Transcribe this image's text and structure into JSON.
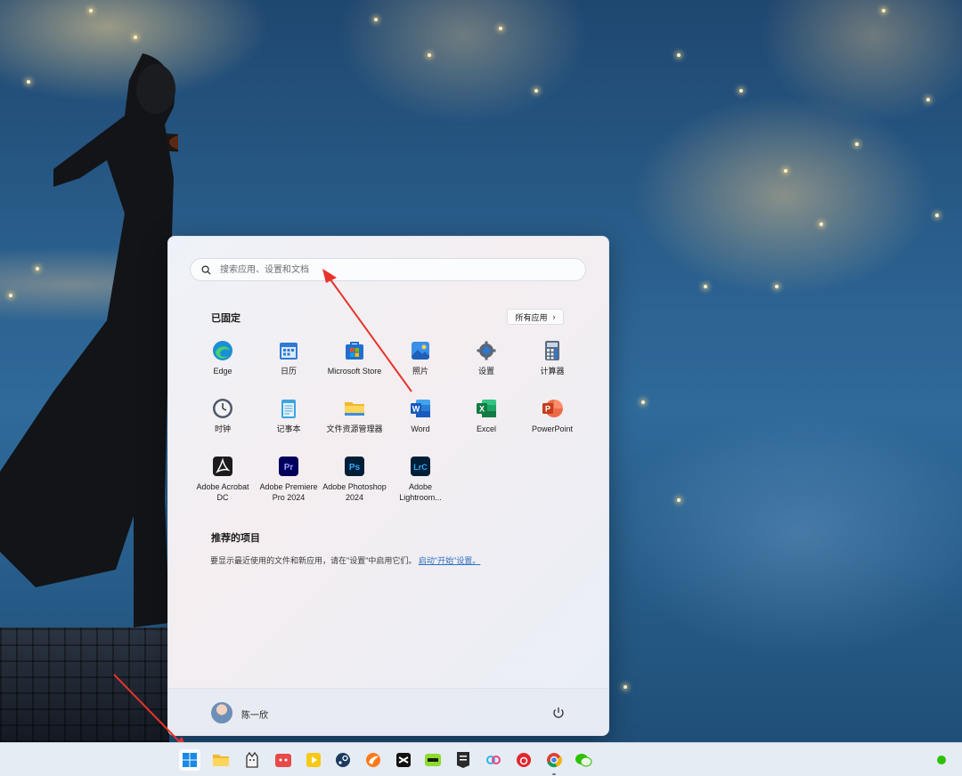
{
  "search": {
    "placeholder": "搜索应用、设置和文档"
  },
  "pinned": {
    "title": "已固定",
    "all_apps_label": "所有应用",
    "apps": [
      {
        "label": "Edge",
        "icon": "edge-icon"
      },
      {
        "label": "日历",
        "icon": "calendar-icon"
      },
      {
        "label": "Microsoft Store",
        "icon": "store-icon"
      },
      {
        "label": "照片",
        "icon": "photos-icon"
      },
      {
        "label": "设置",
        "icon": "gear-icon"
      },
      {
        "label": "计算器",
        "icon": "calculator-icon"
      },
      {
        "label": "时钟",
        "icon": "clock-icon"
      },
      {
        "label": "记事本",
        "icon": "notepad-icon"
      },
      {
        "label": "文件资源管理器",
        "icon": "folder-icon"
      },
      {
        "label": "Word",
        "icon": "word-icon"
      },
      {
        "label": "Excel",
        "icon": "excel-icon"
      },
      {
        "label": "PowerPoint",
        "icon": "powerpoint-icon"
      },
      {
        "label": "Adobe Acrobat DC",
        "icon": "acrobat-icon"
      },
      {
        "label": "Adobe Premiere Pro 2024",
        "icon": "premiere-icon"
      },
      {
        "label": "Adobe Photoshop 2024",
        "icon": "photoshop-icon"
      },
      {
        "label": "Adobe Lightroom...",
        "icon": "lightroom-icon"
      }
    ]
  },
  "recommended": {
    "title": "推荐的项目",
    "text": "要显示最近使用的文件和新应用，请在\"设置\"中启用它们。",
    "link": "启动\"开始\"设置。"
  },
  "user": {
    "name": "陈一欣"
  },
  "taskbar": {
    "icons": [
      "windows-start-icon",
      "file-explorer-icon",
      "app-icon",
      "app-icon",
      "player-icon",
      "steam-icon",
      "app-icon",
      "capcut-icon",
      "app-icon",
      "epic-games-icon",
      "app-icon",
      "netease-music-icon",
      "chrome-icon",
      "wechat-icon"
    ]
  },
  "colors": {
    "accent": "#2f6fbf",
    "arrow": "#e8332a"
  }
}
